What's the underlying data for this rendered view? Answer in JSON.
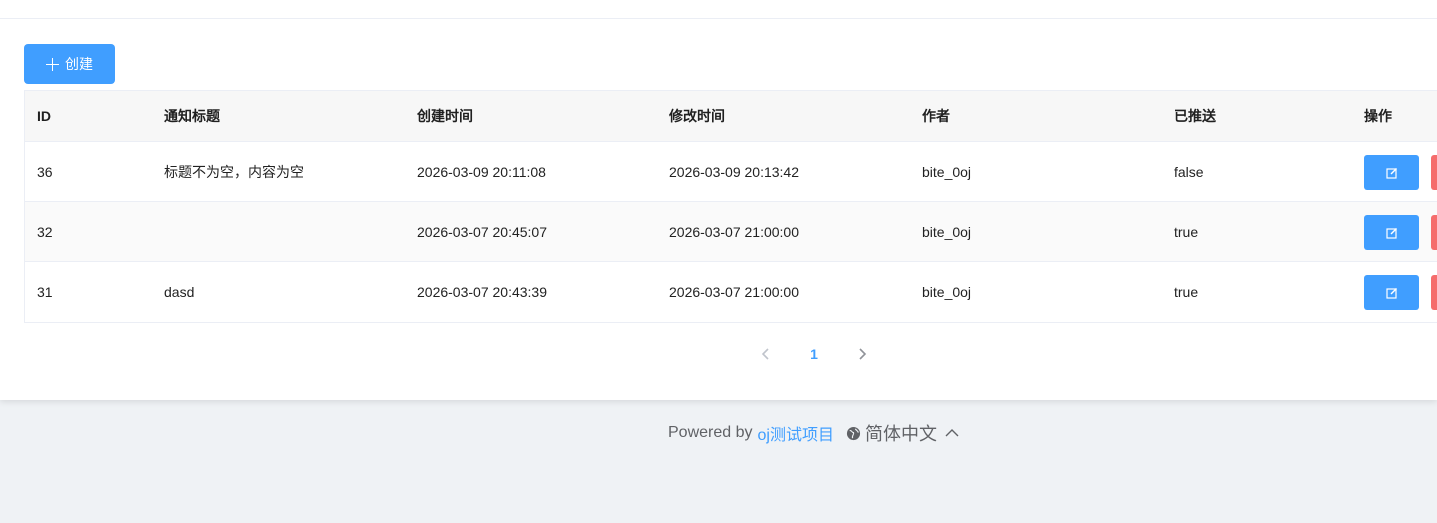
{
  "toolbar": {
    "create_label": "创建"
  },
  "table": {
    "headers": {
      "id": "ID",
      "title": "通知标题",
      "created": "创建时间",
      "modified": "修改时间",
      "author": "作者",
      "sent": "已推送",
      "ops": "操作"
    },
    "rows": [
      {
        "id": "36",
        "title": "标题不为空，内容为空",
        "created": "2026-03-09 20:11:08",
        "modified": "2026-03-09 20:13:42",
        "author": "bite_0oj",
        "sent": "false"
      },
      {
        "id": "32",
        "title": "",
        "created": "2026-03-07 20:45:07",
        "modified": "2026-03-07 21:00:00",
        "author": "bite_0oj",
        "sent": "true"
      },
      {
        "id": "31",
        "title": "dasd",
        "created": "2026-03-07 20:43:39",
        "modified": "2026-03-07 21:00:00",
        "author": "bite_0oj",
        "sent": "true"
      }
    ]
  },
  "pagination": {
    "current_page": "1"
  },
  "footer": {
    "powered_by": "Powered by",
    "project_link": "oj测试项目",
    "language": "简体中文"
  },
  "colors": {
    "primary": "#409eff",
    "danger": "#f56c6c",
    "background": "#eff2f5"
  },
  "icons": [
    "plus-icon",
    "edit-icon",
    "chevron-left-icon",
    "chevron-right-icon",
    "globe-icon",
    "chevron-up-icon"
  ]
}
